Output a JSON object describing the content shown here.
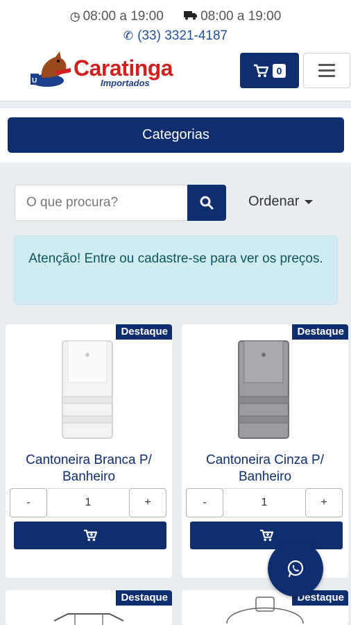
{
  "header": {
    "store_hours": "08:00 a 19:00",
    "delivery_hours": "08:00 a 19:00",
    "phone": "(33) 3321-4187",
    "logo_text": "Caratinga",
    "logo_sub": "Importados",
    "cart_count": "0"
  },
  "categories_label": "Categorias",
  "search": {
    "placeholder": "O que procura?"
  },
  "order_label": "Ordenar",
  "alert": "Atenção! Entre ou cadastre-se para ver os preços.",
  "products": [
    {
      "badge": "Destaque",
      "name": "Cantoneira Branca P/ Banheiro",
      "qty": "1",
      "minus": "-",
      "plus": "+"
    },
    {
      "badge": "Destaque",
      "name": "Cantoneira Cinza P/ Banheiro",
      "qty": "1",
      "minus": "-",
      "plus": "+"
    },
    {
      "badge": "Destaque"
    },
    {
      "badge": "Destaque"
    }
  ],
  "colors": {
    "primary": "#0e2e70",
    "brand_red": "#d0211f",
    "alert_bg": "#d1ecf1"
  }
}
